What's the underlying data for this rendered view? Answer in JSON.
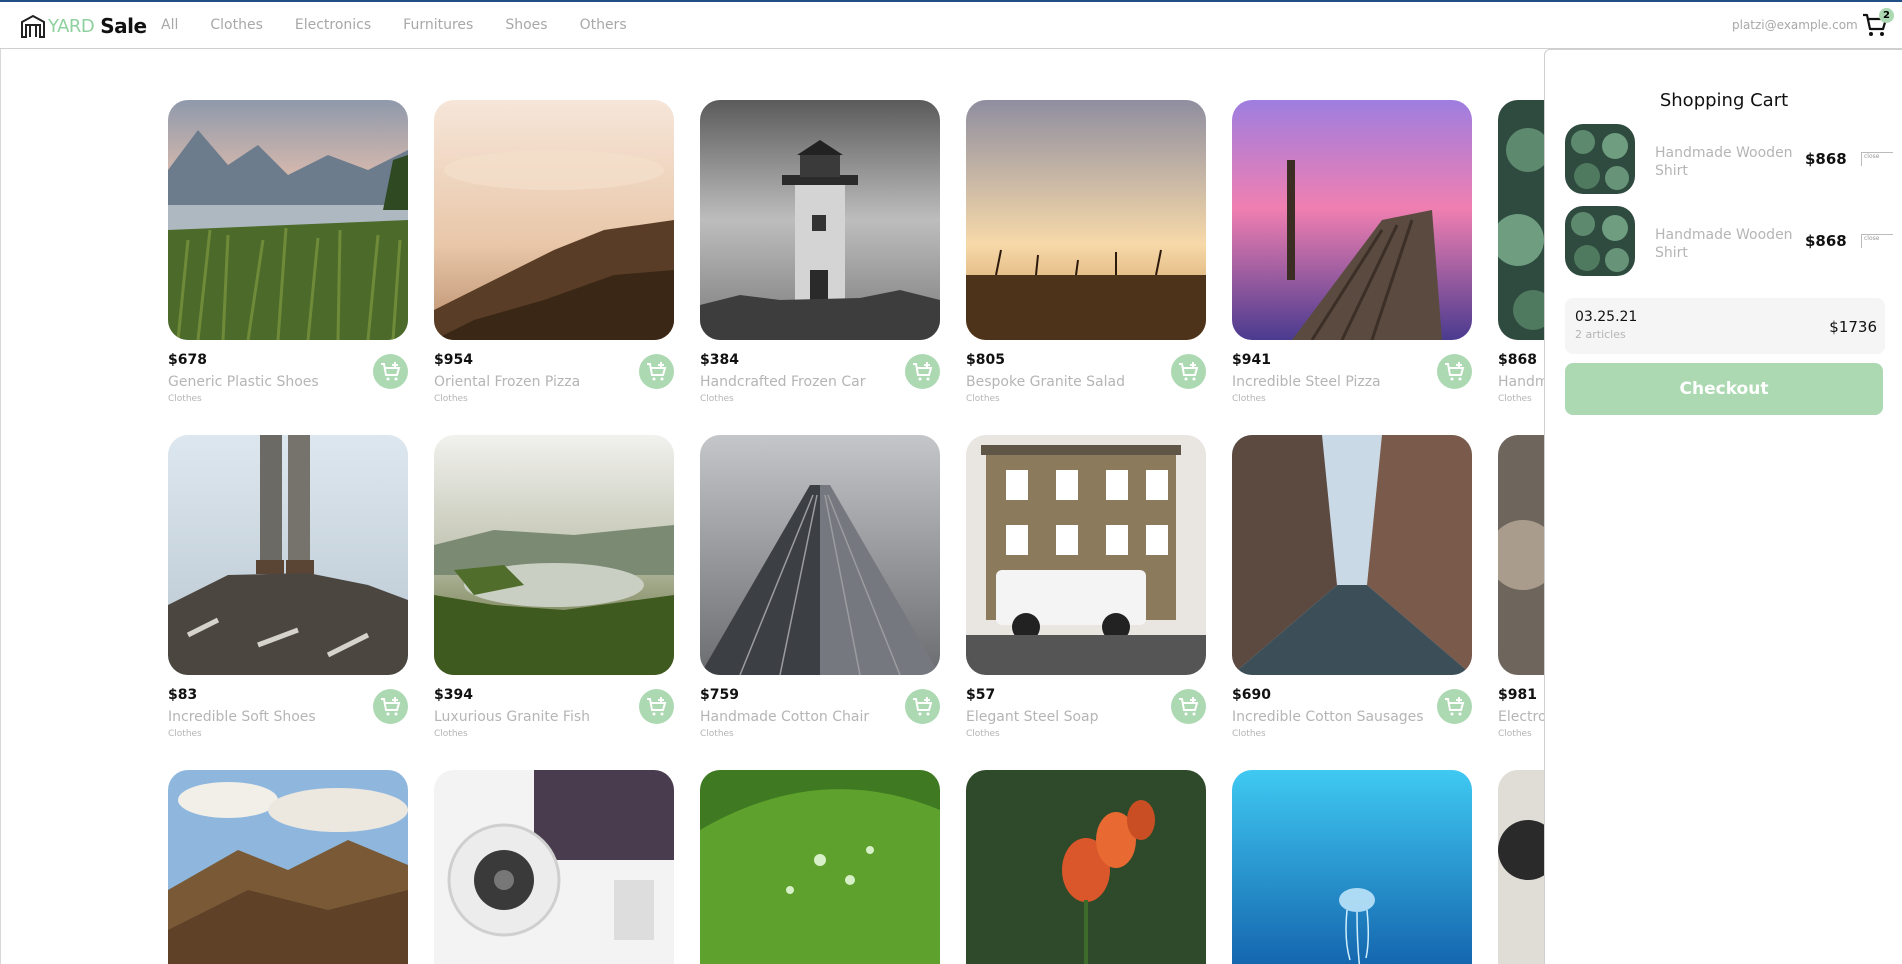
{
  "header": {
    "logo_yard": "YARD",
    "logo_sale": "Sale",
    "email": "platzi@example.com",
    "cart_count": "2",
    "nav": [
      "All",
      "Clothes",
      "Electronics",
      "Furnitures",
      "Shoes",
      "Others"
    ]
  },
  "products": [
    {
      "price": "$678",
      "name": "Generic Plastic Shoes",
      "category": "Clothes"
    },
    {
      "price": "$954",
      "name": "Oriental Frozen Pizza",
      "category": "Clothes"
    },
    {
      "price": "$384",
      "name": "Handcrafted Frozen Car",
      "category": "Clothes"
    },
    {
      "price": "$805",
      "name": "Bespoke Granite Salad",
      "category": "Clothes"
    },
    {
      "price": "$941",
      "name": "Incredible Steel Pizza",
      "category": "Clothes"
    },
    {
      "price": "$868",
      "name": "Handmade Wooden Shirt",
      "category": "Clothes"
    },
    {
      "price": "$83",
      "name": "Incredible Soft Shoes",
      "category": "Clothes"
    },
    {
      "price": "$394",
      "name": "Luxurious Granite Fish",
      "category": "Clothes"
    },
    {
      "price": "$759",
      "name": "Handmade Cotton Chair",
      "category": "Clothes"
    },
    {
      "price": "$57",
      "name": "Elegant Steel Soap",
      "category": "Clothes"
    },
    {
      "price": "$690",
      "name": "Incredible Cotton Sausages",
      "category": "Clothes"
    },
    {
      "price": "$981",
      "name": "Electronic Rubber Towels",
      "category": "Clothes"
    }
  ],
  "cart": {
    "title": "Shopping Cart",
    "items": [
      {
        "name": "Handmade Wooden Shirt",
        "price": "$868",
        "close_alt": "close"
      },
      {
        "name": "Handmade Wooden Shirt",
        "price": "$868",
        "close_alt": "close"
      }
    ],
    "order_date": "03.25.21",
    "order_count": "2 articles",
    "order_total": "$1736",
    "checkout_label": "Checkout"
  },
  "colors": {
    "accent": "#acd9b2",
    "logo_green": "#8fd19e",
    "muted_text": "#b5b5b5",
    "top_border": "#1f4f86"
  }
}
